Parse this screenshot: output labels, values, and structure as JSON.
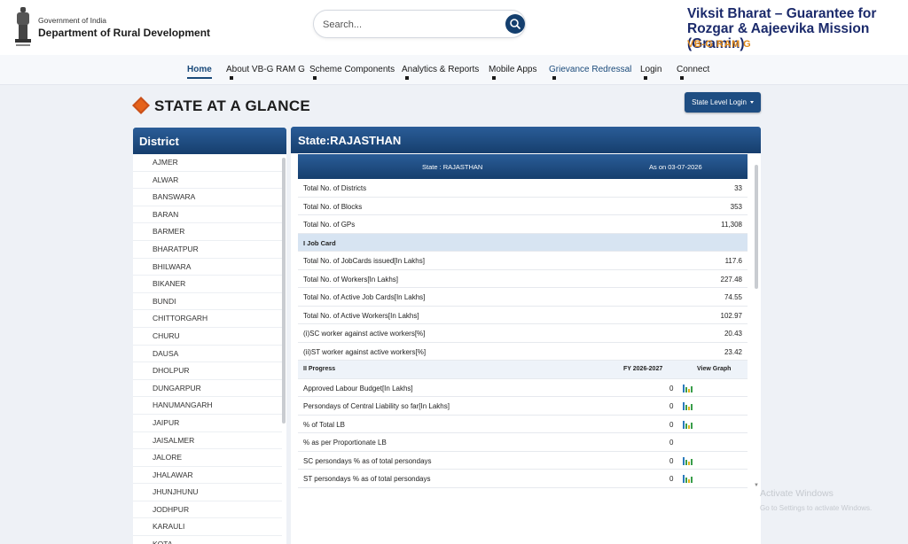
{
  "header": {
    "gov_label": "Government of India",
    "dept_label": "Department of Rural Development",
    "search_placeholder": "Search...",
    "brand_title": "Viksit Bharat – Guarantee for Rozgar & Aajeevika Mission (Gramin)",
    "brand_sub": "VB-G RAM G"
  },
  "nav": [
    "Home",
    "About VB-G RAM G",
    "Scheme Components",
    "Analytics & Reports",
    "Mobile Apps",
    "Grievance Redressal",
    "Login",
    "Connect"
  ],
  "page": {
    "title": "STATE AT A GLANCE",
    "state_login": "State Level Login"
  },
  "district_panel": {
    "title": "District",
    "items": [
      "AJMER",
      "ALWAR",
      "BANSWARA",
      "BARAN",
      "BARMER",
      "BHARATPUR",
      "BHILWARA",
      "BIKANER",
      "BUNDI",
      "CHITTORGARH",
      "CHURU",
      "DAUSA",
      "DHOLPUR",
      "DUNGARPUR",
      "HANUMANGARH",
      "JAIPUR",
      "JAISALMER",
      "JALORE",
      "JHALAWAR",
      "JHUNJHUNU",
      "JODHPUR",
      "KARAULI",
      "KOTA"
    ]
  },
  "state_panel": {
    "title": "State:RAJASTHAN",
    "table_head_state": "State : RAJASTHAN",
    "table_head_date": "As on 03-07-2026",
    "basic_rows": [
      {
        "label": "Total No. of Districts",
        "value": "33"
      },
      {
        "label": "Total No. of Blocks",
        "value": "353"
      },
      {
        "label": "Total No. of GPs",
        "value": "11,308"
      }
    ],
    "section1": "I Job Card",
    "job_rows": [
      {
        "label": "Total No. of JobCards issued[In Lakhs]",
        "value": "117.6"
      },
      {
        "label": "Total No. of Workers[In Lakhs]",
        "value": "227.48"
      },
      {
        "label": "Total No. of Active Job Cards[In Lakhs]",
        "value": "74.55"
      },
      {
        "label": "Total No. of Active Workers[In Lakhs]",
        "value": "102.97"
      },
      {
        "label": "(i)SC worker against active workers[%]",
        "value": "20.43"
      },
      {
        "label": "(ii)ST worker against active workers[%]",
        "value": "23.42"
      }
    ],
    "section2": "II Progress",
    "fy_label": "FY 2026-2027",
    "view_graph_label": "View Graph",
    "progress_rows": [
      {
        "label": "Approved Labour Budget[In Lakhs]",
        "value": "0",
        "graph": true
      },
      {
        "label": "Persondays of Central Liability so far[In Lakhs]",
        "value": "0",
        "graph": true
      },
      {
        "label": "% of Total LB",
        "value": "0",
        "graph": true
      },
      {
        "label": "% as per Proportionate LB",
        "value": "0",
        "graph": false
      },
      {
        "label": "SC persondays % as of total persondays",
        "value": "0",
        "graph": true
      },
      {
        "label": "ST persondays % as of total persondays",
        "value": "0",
        "graph": true
      }
    ]
  },
  "watermark": {
    "line1": "Activate Windows",
    "line2": "Go to Settings to activate Windows."
  },
  "colors": {
    "primary_blue": "#1e4d82",
    "brand_navy": "#1b2a6b",
    "brand_orange": "#e08a1c",
    "section_bg": "#d7e4f2"
  }
}
